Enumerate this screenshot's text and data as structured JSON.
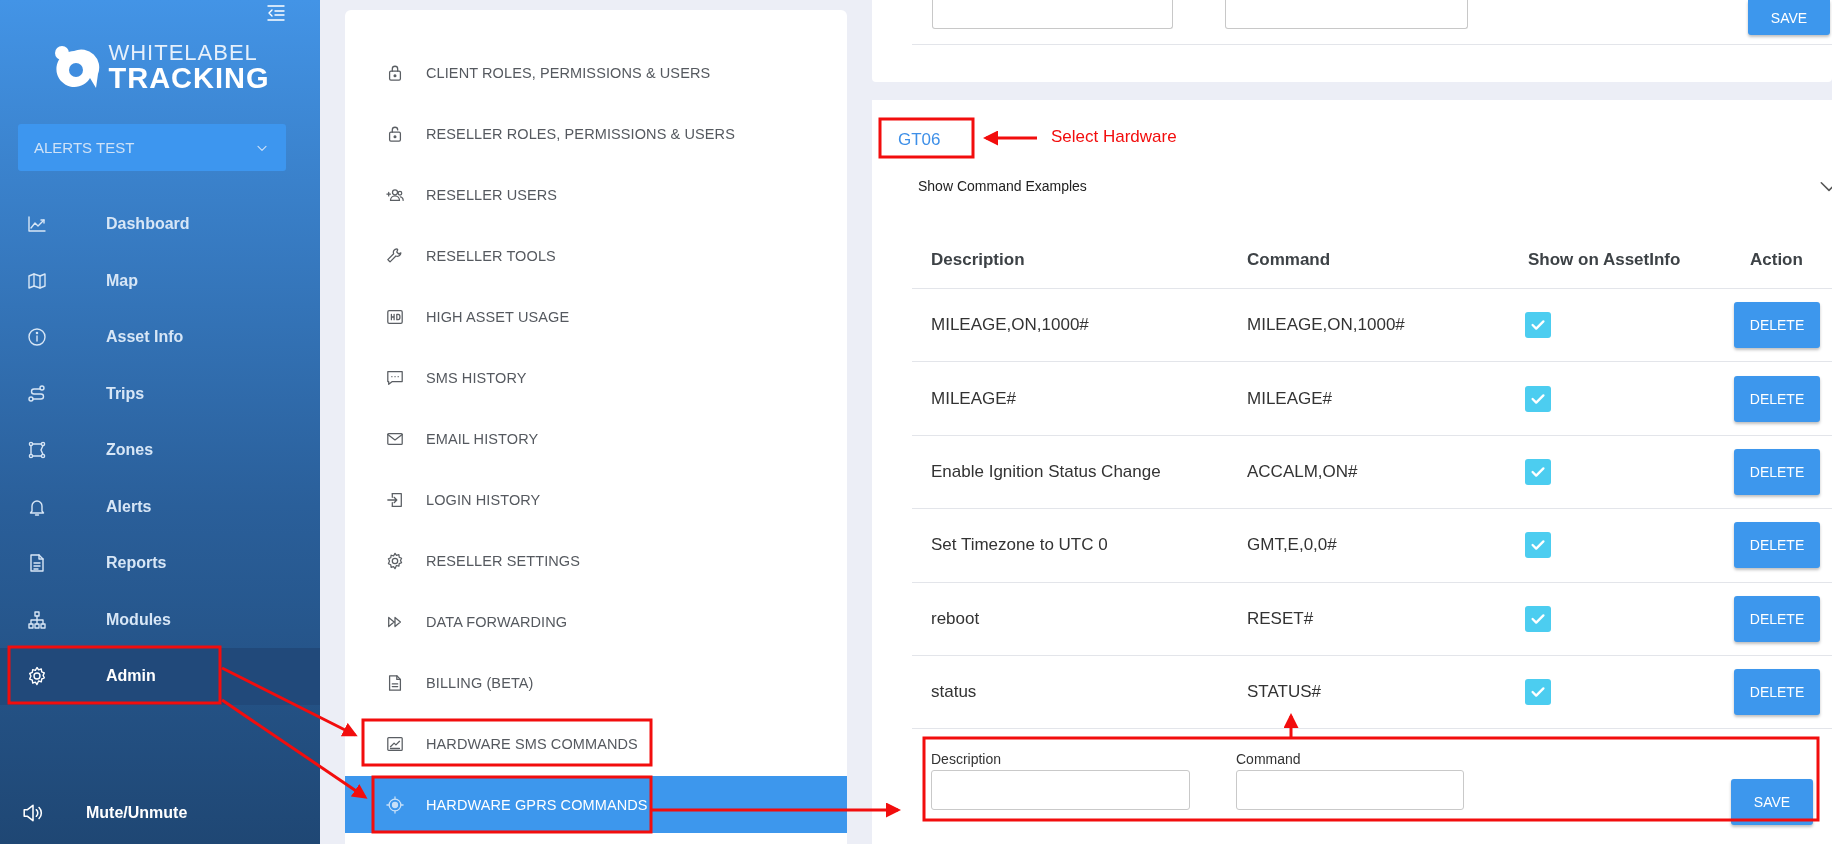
{
  "sidebar": {
    "logo": {
      "line1": "WHITELABEL",
      "line2": "TRACKING"
    },
    "account_select": {
      "value": "ALERTS TEST"
    },
    "nav_items": [
      {
        "label": "Dashboard",
        "selected": false
      },
      {
        "label": "Map",
        "selected": false
      },
      {
        "label": "Asset Info",
        "selected": false
      },
      {
        "label": "Trips",
        "selected": false
      },
      {
        "label": "Zones",
        "selected": false
      },
      {
        "label": "Alerts",
        "selected": false
      },
      {
        "label": "Reports",
        "selected": false
      },
      {
        "label": "Modules",
        "selected": false
      },
      {
        "label": "Admin",
        "selected": true
      }
    ],
    "mute": {
      "label": "Mute/Unmute"
    }
  },
  "admin_menu": {
    "items": [
      {
        "label": "CLIENT ROLES, PERMISSIONS & USERS",
        "selected": false
      },
      {
        "label": "RESELLER ROLES, PERMISSIONS & USERS",
        "selected": false
      },
      {
        "label": "RESELLER USERS",
        "selected": false
      },
      {
        "label": "RESELLER TOOLS",
        "selected": false
      },
      {
        "label": "HIGH ASSET USAGE",
        "selected": false
      },
      {
        "label": "SMS HISTORY",
        "selected": false
      },
      {
        "label": "EMAIL HISTORY",
        "selected": false
      },
      {
        "label": "LOGIN HISTORY",
        "selected": false
      },
      {
        "label": "RESELLER SETTINGS",
        "selected": false
      },
      {
        "label": "DATA FORWARDING",
        "selected": false
      },
      {
        "label": "BILLING (BETA)",
        "selected": false
      },
      {
        "label": "HARDWARE SMS COMMANDS",
        "selected": false
      },
      {
        "label": "HARDWARE GPRS COMMANDS",
        "selected": true
      }
    ]
  },
  "top_card": {
    "save_button": "SAVE"
  },
  "commands_card": {
    "hardware": "GT06",
    "examples_toggle": {
      "label": "Show Command Examples",
      "expanded": false
    },
    "columns": [
      "Description",
      "Command",
      "Show on AssetInfo",
      "Action"
    ],
    "rows": [
      {
        "description": "MILEAGE,ON,1000#",
        "command": "MILEAGE,ON,1000#",
        "show_on_assetinfo": true,
        "action": "DELETE"
      },
      {
        "description": "MILEAGE#",
        "command": "MILEAGE#",
        "show_on_assetinfo": true,
        "action": "DELETE"
      },
      {
        "description": "Enable Ignition Status Change",
        "command": "ACCALM,ON#",
        "show_on_assetinfo": true,
        "action": "DELETE"
      },
      {
        "description": "Set Timezone to UTC 0",
        "command": "GMT,E,0,0#",
        "show_on_assetinfo": true,
        "action": "DELETE"
      },
      {
        "description": "reboot",
        "command": "RESET#",
        "show_on_assetinfo": true,
        "action": "DELETE"
      },
      {
        "description": "status",
        "command": "STATUS#",
        "show_on_assetinfo": true,
        "action": "DELETE"
      }
    ],
    "new_command": {
      "description_label": "Description",
      "command_label": "Command",
      "save_button": "SAVE"
    }
  },
  "annotations": {
    "label": "Select Hardware"
  }
}
